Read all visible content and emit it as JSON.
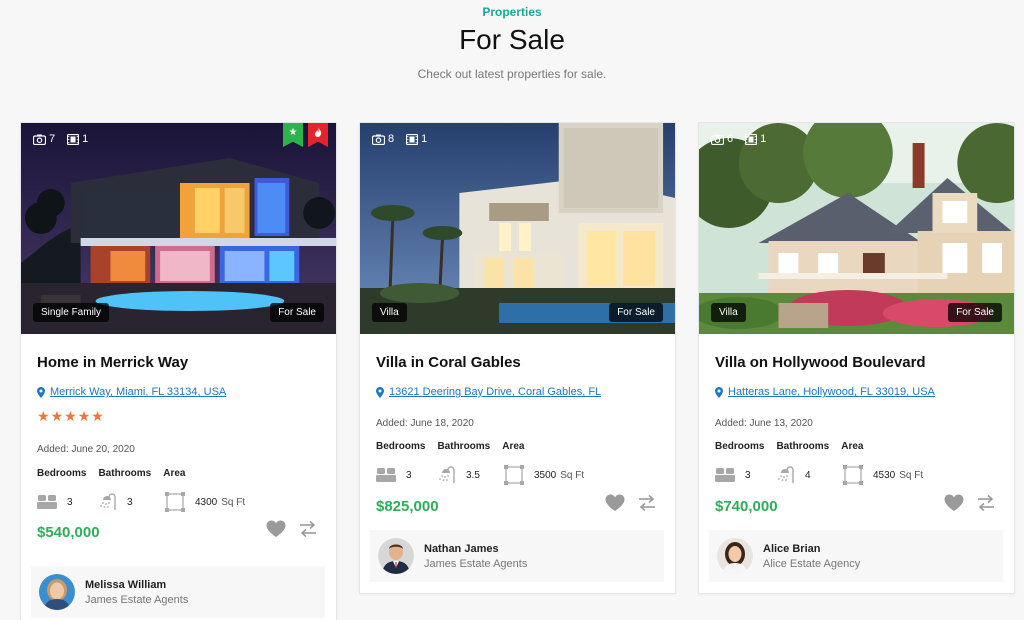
{
  "header": {
    "eyebrow": "Properties",
    "title": "For Sale",
    "subtitle": "Check out latest properties for sale."
  },
  "labels": {
    "added_prefix": "Added:",
    "bedrooms": "Bedrooms",
    "bathrooms": "Bathrooms",
    "area": "Area",
    "area_unit": "Sq Ft"
  },
  "colors": {
    "accent": "#1ea69a",
    "price": "#2eae58",
    "link": "#1f75c4",
    "stars": "#f2743b",
    "featured_ribbon": "#2eb34a",
    "hot_ribbon": "#e3242b"
  },
  "properties": [
    {
      "name": "Home in Merrick Way",
      "address": "Merrick Way, Miami, FL 33134, USA",
      "photos": "7",
      "videos": "1",
      "type": "Single Family",
      "status": "For Sale",
      "rating": 5,
      "ribbons": [
        "star-icon",
        "flame-icon"
      ],
      "added": "Added: June 20, 2020",
      "bedrooms": "3",
      "bathrooms": "3",
      "area": "4300",
      "price": "$540,000",
      "agent": {
        "name": "Melissa William",
        "agency": "James Estate Agents"
      }
    },
    {
      "name": "Villa in Coral Gables",
      "address": "13621 Deering Bay Drive, Coral Gables, FL",
      "photos": "8",
      "videos": "1",
      "type": "Villa",
      "status": "For Sale",
      "added": "Added: June 18, 2020",
      "bedrooms": "3",
      "bathrooms": "3.5",
      "area": "3500",
      "price": "$825,000",
      "agent": {
        "name": "Nathan James",
        "agency": "James Estate Agents"
      }
    },
    {
      "name": "Villa on Hollywood Boulevard",
      "address": "Hatteras Lane, Hollywood, FL 33019, USA",
      "photos": "6",
      "videos": "1",
      "type": "Villa",
      "status": "For Sale",
      "added": "Added: June 13, 2020",
      "bedrooms": "3",
      "bathrooms": "4",
      "area": "4530",
      "price": "$740,000",
      "agent": {
        "name": "Alice Brian",
        "agency": "Alice Estate Agency"
      }
    }
  ]
}
